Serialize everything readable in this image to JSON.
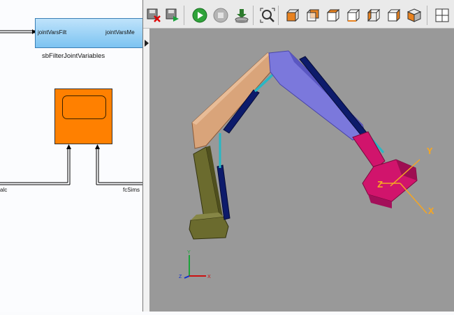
{
  "diagram": {
    "filter_block": {
      "input_port": "jointVarsFilt",
      "output_port": "jointVarsMe",
      "name": "sbFilterJointVariables"
    },
    "scope_block": {
      "name": ""
    },
    "signals": {
      "left_signal": "alc",
      "right_signal": "fcSims"
    }
  },
  "viewer": {
    "toolbar": [
      {
        "name": "close-all-icon"
      },
      {
        "name": "save-viewpoint-icon"
      },
      {
        "name": "play-icon"
      },
      {
        "name": "stop-icon"
      },
      {
        "name": "step-icon"
      },
      {
        "name": "zoom-fit-icon"
      },
      {
        "name": "view-front-icon"
      },
      {
        "name": "view-back-icon"
      },
      {
        "name": "view-top-icon"
      },
      {
        "name": "view-bottom-icon"
      },
      {
        "name": "view-left-icon"
      },
      {
        "name": "view-right-icon"
      },
      {
        "name": "view-iso-icon"
      },
      {
        "name": "layout-icon"
      }
    ],
    "frame_labels": {
      "y": "Y",
      "z": "Z",
      "x": "X"
    },
    "triad_labels": {
      "y": "Y",
      "z": "Z",
      "x": "X"
    },
    "colors": {
      "background": "#999999",
      "base": "#6b6b2e",
      "boom": "#d9a47a",
      "stick": "#7b78dc",
      "cylinder": "#0d1b6b",
      "rod": "#28b7c4",
      "gripper": "#d1146c",
      "frame": "#f5a623"
    }
  }
}
